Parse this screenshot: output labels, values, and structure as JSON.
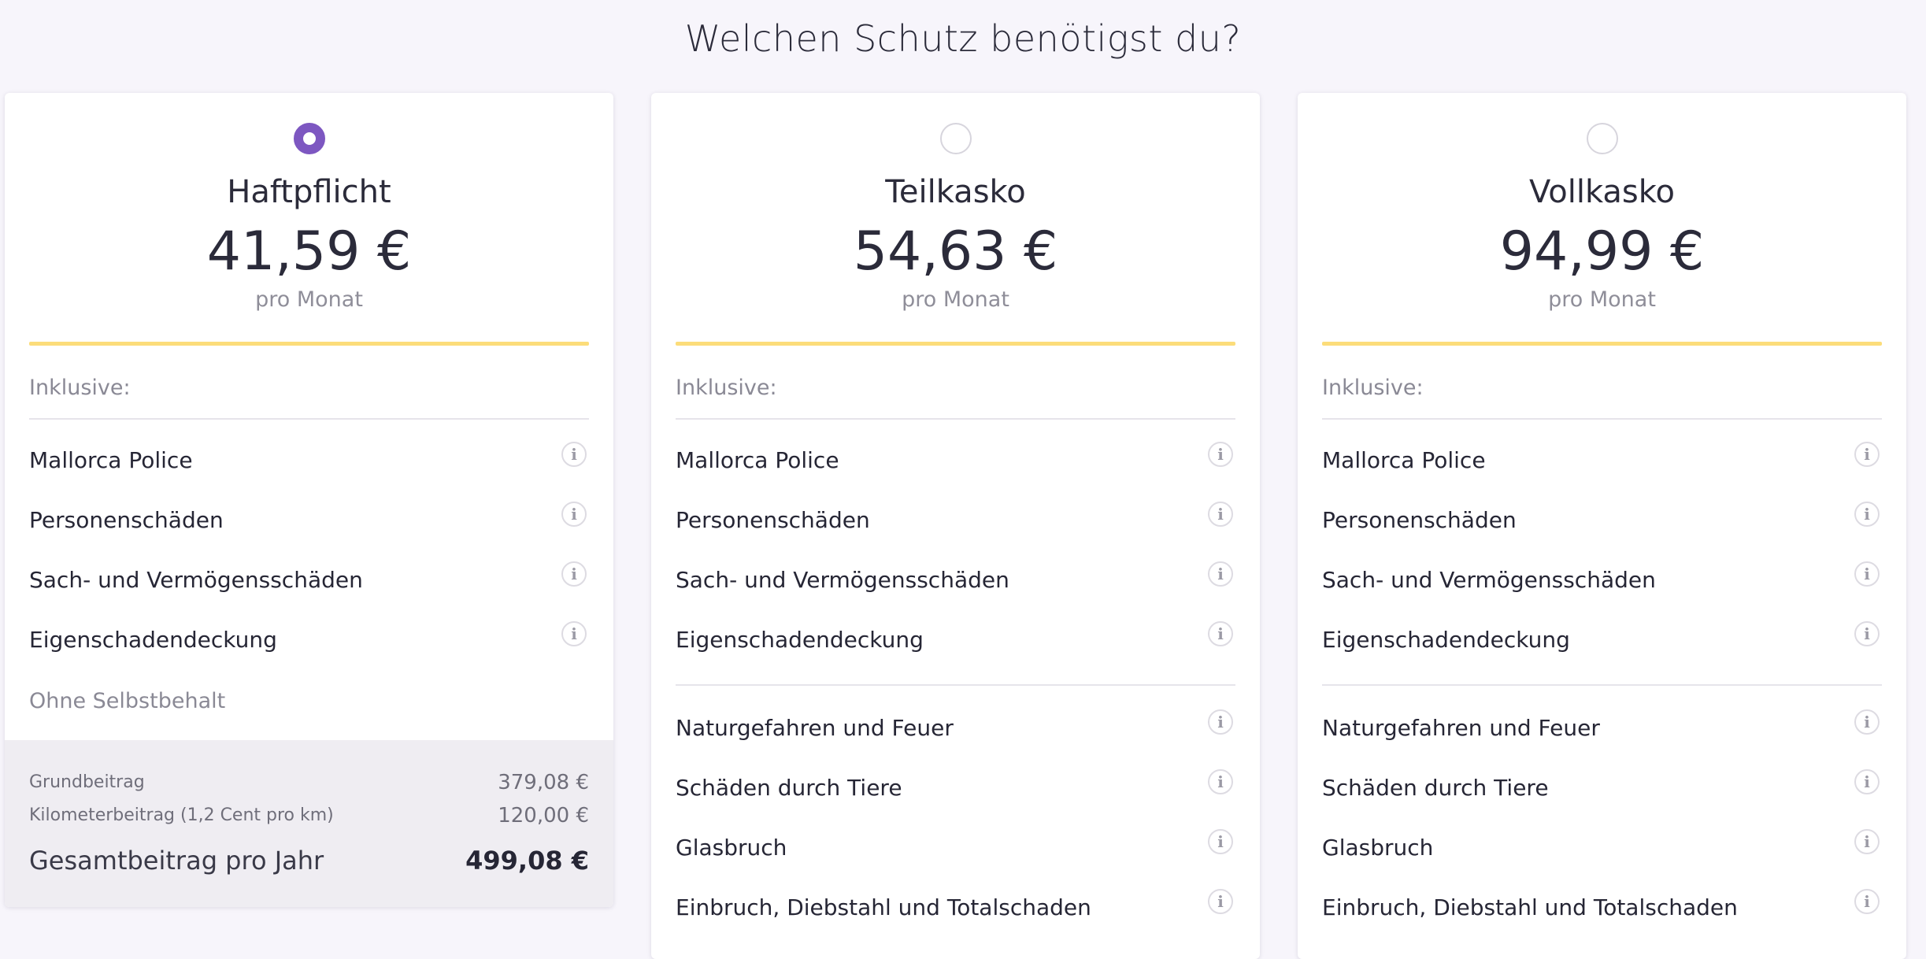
{
  "page": {
    "title": "Welchen Schutz benötigst du?"
  },
  "colors": {
    "accent": "#7d57c1",
    "divider_yellow": "#fcdd7a",
    "background": "#f7f5fb"
  },
  "plans": [
    {
      "name": "Haftpflicht",
      "price": "41,59 €",
      "period": "pro Monat",
      "selected": true,
      "included_label": "Inklusive:",
      "features": [
        {
          "label": "Mallorca Police",
          "icon": "info-icon"
        },
        {
          "label": "Personenschäden",
          "icon": "info-icon"
        },
        {
          "label": "Sach- und Vermögensschäden",
          "icon": "info-icon"
        },
        {
          "label": "Eigenschadendeckung",
          "icon": "info-icon"
        }
      ],
      "deductible": "Ohne Selbstbehalt",
      "summary": {
        "base_label": "Grundbeitrag",
        "base_value": "379,08 €",
        "km_label": "Kilometerbeitrag (1,2 Cent pro km)",
        "km_value": "120,00 €",
        "total_label": "Gesamtbeitrag pro Jahr",
        "total_value": "499,08 €"
      }
    },
    {
      "name": "Teilkasko",
      "price": "54,63 €",
      "period": "pro Monat",
      "selected": false,
      "included_label": "Inklusive:",
      "features": [
        {
          "label": "Mallorca Police",
          "icon": "info-icon"
        },
        {
          "label": "Personenschäden",
          "icon": "info-icon"
        },
        {
          "label": "Sach- und Vermögensschäden",
          "icon": "info-icon"
        },
        {
          "label": "Eigenschadendeckung",
          "icon": "info-icon"
        }
      ],
      "extra_features": [
        {
          "label": "Naturgefahren und Feuer",
          "icon": "info-icon"
        },
        {
          "label": "Schäden durch Tiere",
          "icon": "info-icon"
        },
        {
          "label": "Glasbruch",
          "icon": "info-icon"
        },
        {
          "label": "Einbruch, Diebstahl und Totalschaden",
          "icon": "info-icon"
        }
      ]
    },
    {
      "name": "Vollkasko",
      "price": "94,99 €",
      "period": "pro Monat",
      "selected": false,
      "included_label": "Inklusive:",
      "features": [
        {
          "label": "Mallorca Police",
          "icon": "info-icon"
        },
        {
          "label": "Personenschäden",
          "icon": "info-icon"
        },
        {
          "label": "Sach- und Vermögensschäden",
          "icon": "info-icon"
        },
        {
          "label": "Eigenschadendeckung",
          "icon": "info-icon"
        }
      ],
      "extra_features": [
        {
          "label": "Naturgefahren und Feuer",
          "icon": "info-icon"
        },
        {
          "label": "Schäden durch Tiere",
          "icon": "info-icon"
        },
        {
          "label": "Glasbruch",
          "icon": "info-icon"
        },
        {
          "label": "Einbruch, Diebstahl und Totalschaden",
          "icon": "info-icon"
        }
      ]
    }
  ]
}
